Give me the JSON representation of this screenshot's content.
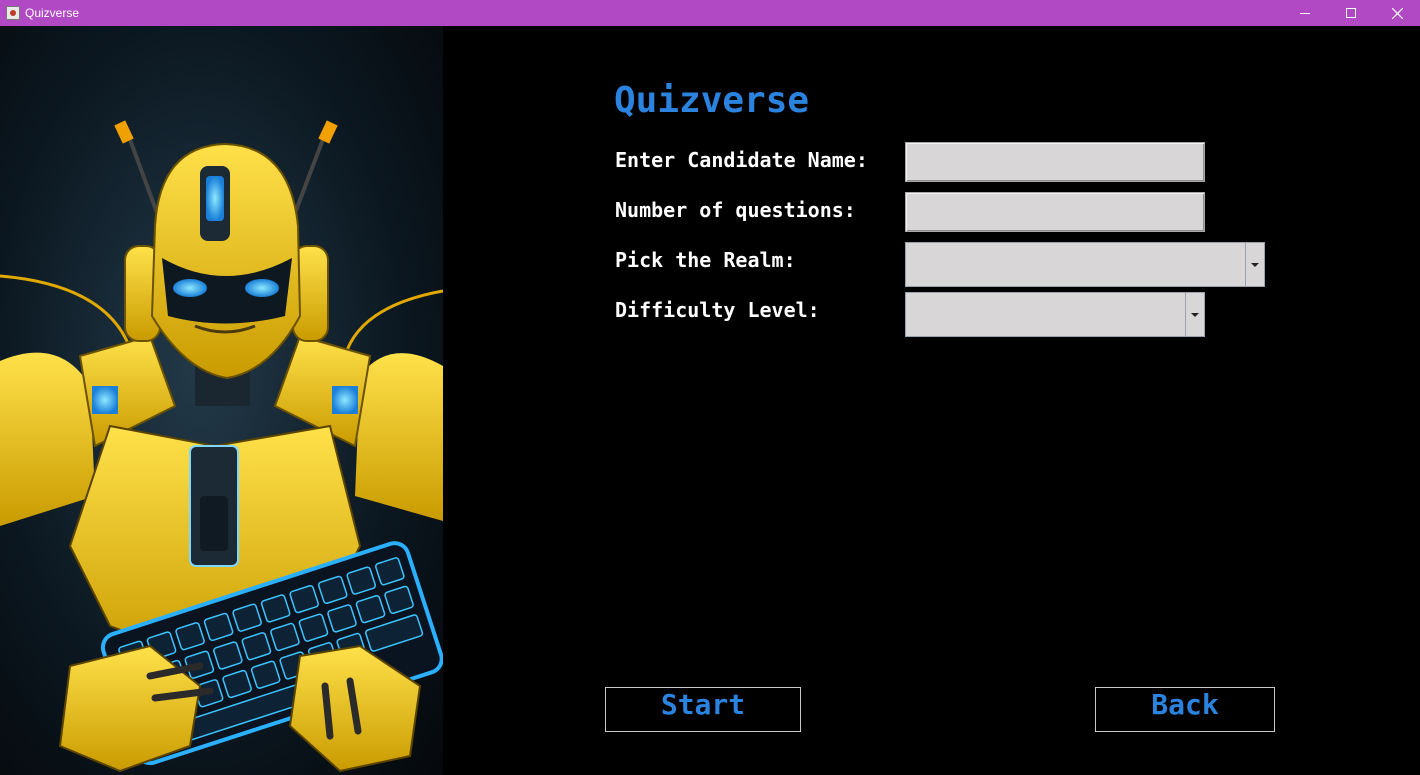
{
  "window": {
    "title": "Quizverse",
    "controls": [
      "minimize-icon",
      "maximize-icon",
      "close-icon"
    ]
  },
  "colors": {
    "titlebar": "#b148c4",
    "accent": "#2b83e0",
    "background": "#000000",
    "field": "#d8d6d6",
    "label": "#ffffff"
  },
  "art": {
    "subject": "yellow-robot-holding-keyboard-image"
  },
  "form": {
    "heading": "Quizverse",
    "candidate_name_label": "Enter Candidate Name:",
    "candidate_name_value": "",
    "num_questions_label": "Number of questions:",
    "num_questions_value": "",
    "realm_label": "Pick the Realm:",
    "realm_selected": "",
    "difficulty_label": "Difficulty Level:",
    "difficulty_selected": ""
  },
  "buttons": {
    "start_label": "Start",
    "back_label": "Back"
  }
}
